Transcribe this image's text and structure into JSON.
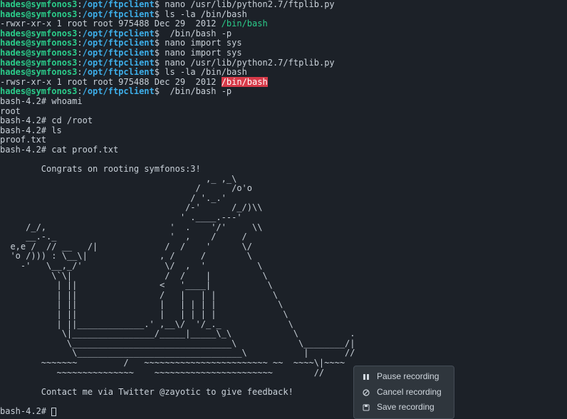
{
  "prompt": {
    "user_host": "hades@symfonos3",
    "sep": ":",
    "path": "/opt/ftpclient",
    "symbol": "$"
  },
  "lines": [
    {
      "type": "prompt",
      "cmd": " nano /usr/lib/python2.7/ftplib.py"
    },
    {
      "type": "prompt",
      "cmd": " ls -la /bin/bash"
    },
    {
      "type": "ls",
      "a": "-rwxr-xr-x 1 root root 975488 Dec 29  2012 ",
      "b": "/bin/bash",
      "hl": "cyan"
    },
    {
      "type": "prompt",
      "cmd": "  /bin/bash -p"
    },
    {
      "type": "prompt",
      "cmd": " nano import sys"
    },
    {
      "type": "prompt",
      "cmd": " nano import sys"
    },
    {
      "type": "prompt",
      "cmd": " nano /usr/lib/python2.7/ftplib.py"
    },
    {
      "type": "prompt",
      "cmd": " ls -la /bin/bash"
    },
    {
      "type": "ls",
      "a": "-rwsr-xr-x 1 root root 975488 Dec 29  2012 ",
      "b": "/bin/bash",
      "hl": "red"
    },
    {
      "type": "prompt",
      "cmd": "  /bin/bash -p"
    },
    {
      "type": "plain",
      "text": "bash-4.2# whoami"
    },
    {
      "type": "plain",
      "text": "root"
    },
    {
      "type": "plain",
      "text": "bash-4.2# cd /root"
    },
    {
      "type": "plain",
      "text": "bash-4.2# ls"
    },
    {
      "type": "plain",
      "text": "proof.txt"
    },
    {
      "type": "plain",
      "text": "bash-4.2# cat proof.txt"
    },
    {
      "type": "plain",
      "text": ""
    },
    {
      "type": "plain",
      "text": "        Congrats on rooting symfonos:3!"
    },
    {
      "type": "plain",
      "text": "                                        ,_ ,_\\"
    },
    {
      "type": "plain",
      "text": "                                      /      /o'o"
    },
    {
      "type": "plain",
      "text": "                                     / '._.'"
    },
    {
      "type": "plain",
      "text": "                                    /-'      /_/)\\\\"
    },
    {
      "type": "plain",
      "text": "                                   ' .____.---'"
    },
    {
      "type": "plain",
      "text": "     /_/,                        '  .    '/'     \\\\"
    },
    {
      "type": "plain",
      "text": "     __.-._                      '  ,    /     /"
    },
    {
      "type": "plain",
      "text": "  e,e /  // __   /|             /  /    '      \\/"
    },
    {
      "type": "plain",
      "text": "  'o /))) : \\__\\|              , /     /        \\"
    },
    {
      "type": "plain",
      "text": "    -'   \\__,_/'                \\/  ,  '          \\"
    },
    {
      "type": "plain",
      "text": "          \\`\\|                  /  /    |          \\"
    },
    {
      "type": "plain",
      "text": "           | ||                <   '____|           \\"
    },
    {
      "type": "plain",
      "text": "           | ||                /   |   | |           \\"
    },
    {
      "type": "plain",
      "text": "           | ||                |   | | | |            \\"
    },
    {
      "type": "plain",
      "text": "           | ||                |   | | | |             \\"
    },
    {
      "type": "plain",
      "text": "           | ||_____________.' ,__\\/  '/_._             \\"
    },
    {
      "type": "plain",
      "text": "            \\|________________/_____|_____\\_\\            \\          ."
    },
    {
      "type": "plain",
      "text": "             \\_______________________________\\            \\________/|"
    },
    {
      "type": "plain",
      "text": "              \\________________________________\\           |       //"
    },
    {
      "type": "plain",
      "text": "        ~~~~~~~         /   ~~~~~~~~~~~~~~~~~~~~~~~~ ~~  ~~~~\\|~~~~"
    },
    {
      "type": "plain",
      "text": "           ~~~~~~~~~~~~~~~    ~~~~~~~~~~~~~~~~~~~~~~~        //"
    },
    {
      "type": "plain",
      "text": ""
    },
    {
      "type": "plain",
      "text": "        Contact me via Twitter @zayotic to give feedback!"
    },
    {
      "type": "plain",
      "text": ""
    },
    {
      "type": "cursor",
      "text": "bash-4.2# "
    }
  ],
  "popup": {
    "pause": "Pause recording",
    "cancel": "Cancel recording",
    "save": "Save recording"
  },
  "icons": {
    "pause": "pause-icon",
    "cancel": "cancel-icon",
    "save": "save-icon"
  }
}
